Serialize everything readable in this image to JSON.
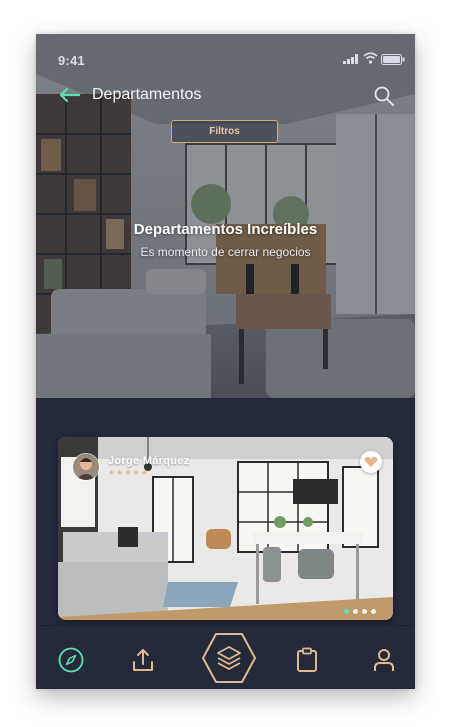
{
  "status_bar": {
    "time": "9:41"
  },
  "header": {
    "title": "Departamentos"
  },
  "filters": {
    "label": "Filtros"
  },
  "hero": {
    "title": "Departamentos Increíbles",
    "subtitle": "Es momento de cerrar negocios"
  },
  "listing": {
    "author": "Jorge Márquez",
    "stars": "★★★★★",
    "rating": 5,
    "favorite": true,
    "carousel_active": 1,
    "carousel_total": 4
  },
  "tabbar": {
    "items": [
      "compass-icon",
      "upload-icon",
      "layers-icon",
      "clipboard-icon",
      "user-icon"
    ]
  },
  "colors": {
    "background": "#252a3a",
    "accent_mint": "#5ee0b6",
    "accent_gold": "#dfb98d"
  }
}
